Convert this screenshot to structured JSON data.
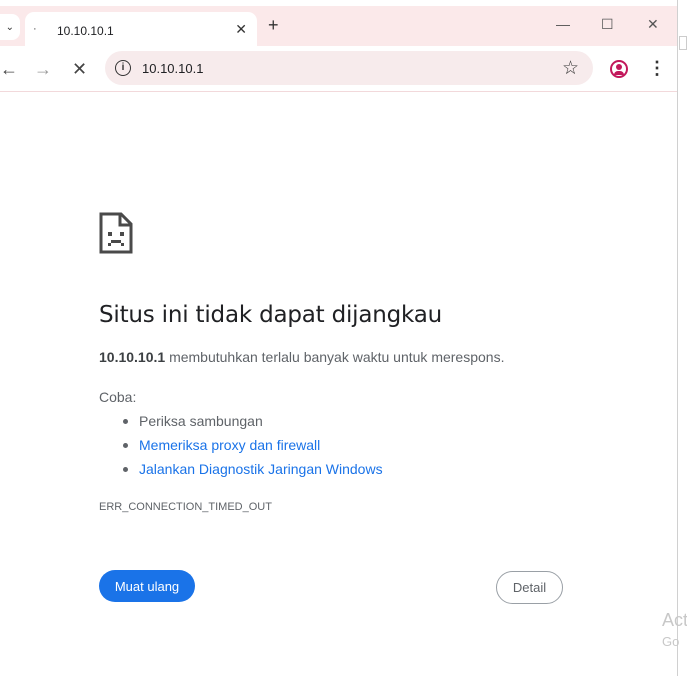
{
  "browser": {
    "tab": {
      "title": "10.10.10.1",
      "loading_glyph": "·",
      "close_glyph": "✕"
    },
    "new_tab_glyph": "+",
    "window_controls": {
      "minimize": "—",
      "maximize": "☐",
      "close": "✕"
    },
    "toolbar": {
      "back_glyph": "←",
      "forward_glyph": "→",
      "stop_glyph": "✕",
      "url": "10.10.10.1",
      "star_glyph": "☆",
      "menu_glyph": "⋮"
    },
    "icons": {
      "site_info": "info-icon",
      "bookmark": "star-icon",
      "profile": "profile-icon",
      "menu": "kebab-menu-icon",
      "error": "sad-page-icon"
    }
  },
  "error_page": {
    "title": "Situs ini tidak dapat dijangkau",
    "host": "10.10.10.1",
    "message": "membutuhkan terlalu banyak waktu untuk merespons.",
    "try_label": "Coba:",
    "suggestions": [
      {
        "text": "Periksa sambungan",
        "link": false
      },
      {
        "text": "Memeriksa proxy dan firewall",
        "link": true
      },
      {
        "text": "Jalankan Diagnostik Jaringan Windows",
        "link": true
      }
    ],
    "error_code": "ERR_CONNECTION_TIMED_OUT",
    "reload_label": "Muat ulang",
    "detail_label": "Detail"
  },
  "watermark": {
    "line1": "Act",
    "line2": "Go"
  },
  "colors": {
    "tabstrip_bg": "#fbe9ea",
    "omnibox_bg": "#f7ebec",
    "link": "#1a73e8",
    "primary_button": "#1a73e8",
    "profile_accent": "#c2185b"
  }
}
